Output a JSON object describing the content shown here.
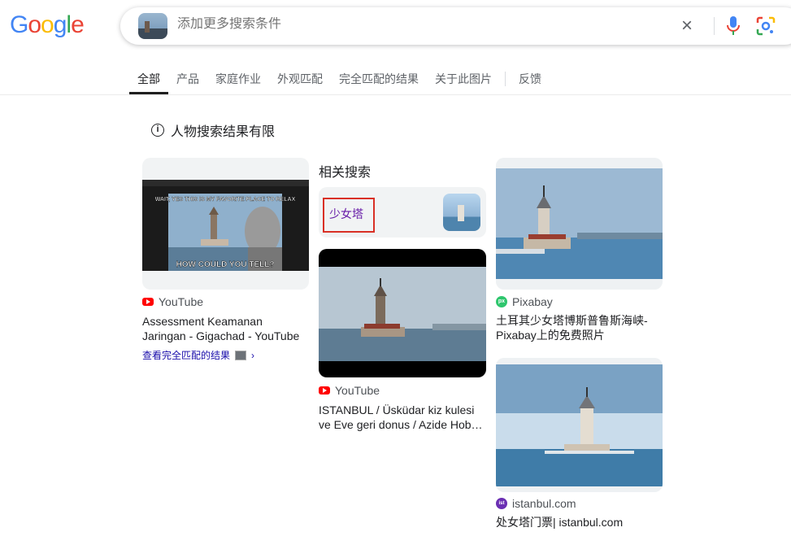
{
  "logo": [
    "G",
    "o",
    "o",
    "g",
    "l",
    "e"
  ],
  "search": {
    "placeholder": "添加更多搜索条件"
  },
  "tabs": [
    {
      "label": "全部",
      "active": true
    },
    {
      "label": "产品"
    },
    {
      "label": "家庭作业"
    },
    {
      "label": "外观匹配"
    },
    {
      "label": "完全匹配的结果"
    },
    {
      "label": "关于此图片"
    },
    {
      "label": "反馈"
    }
  ],
  "notice": {
    "text": "人物搜索结果有限"
  },
  "results": {
    "left": {
      "source": "YouTube",
      "title_line1": "Assessment Keamanan",
      "title_line2": "Jaringan - Gigachad - YouTube",
      "meme_top": "WAIT, YES THIS IS MY FAVORITE PLACE TO RELAX",
      "meme_bottom": "HOW COULD YOU TELL?",
      "exact_link": "查看完全匹配的结果",
      "chevron": "›"
    },
    "middle": {
      "source": "YouTube",
      "title_line1": "ISTANBUL / Üsküdar kiz kulesi",
      "title_line2": "ve Eve geri donus / Azide Hob…"
    },
    "right1": {
      "source": "Pixabay",
      "title_line1": "土耳其少女塔博斯普鲁斯海峡-",
      "title_line2": "Pixabay上的免费照片"
    },
    "right2": {
      "source": "istanbul.com",
      "title_line1": "处女塔门票| istanbul.com"
    }
  },
  "related": {
    "heading": "相关搜索",
    "chip_label": "少女塔"
  },
  "icons": {
    "clear": "×",
    "info": "i"
  },
  "colors": {
    "link": "#1a0dab",
    "visited": "#681da8",
    "highlight_box": "#d93025"
  }
}
